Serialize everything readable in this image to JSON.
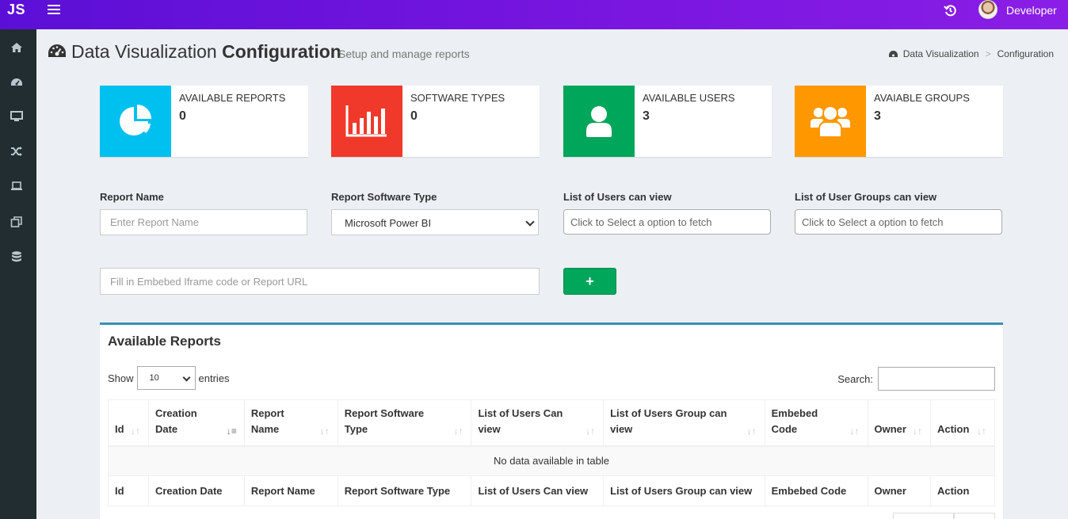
{
  "app": {
    "logo": "JS",
    "user_name": "Developer"
  },
  "sidebar": {
    "icons": [
      "home-icon",
      "dashboard-icon",
      "desktop-icon",
      "shuffle-icon",
      "laptop-icon",
      "clone-icon",
      "database-icon"
    ]
  },
  "header": {
    "title_light": "Data Visualization ",
    "title_bold": "Configuration",
    "subtitle": "Setup and manage reports",
    "breadcrumb": [
      "Data Visualization",
      "Configuration"
    ]
  },
  "info_boxes": [
    {
      "label": "AVAILABLE REPORTS",
      "value": "0",
      "color": "#00c0ef",
      "icon": "pie-chart-icon"
    },
    {
      "label": "SOFTWARE TYPES",
      "value": "0",
      "color": "#f39c12",
      "icon": "bar-chart-icon"
    },
    {
      "label": "AVAILABLE USERS",
      "value": "3",
      "color": "#00a65a",
      "icon": "user-icon"
    },
    {
      "label": "AVAIABLE GROUPS",
      "value": "3",
      "color": "#ff9800",
      "icon": "users-icon"
    }
  ],
  "form": {
    "report_name_label": "Report Name",
    "report_name_placeholder": "Enter Report Name",
    "software_type_label": "Report Software Type",
    "software_type_value": "Microsoft Power BI",
    "users_label": "List of Users can view",
    "users_placeholder": "Click to Select a option to fetch",
    "groups_label": "List of User Groups can view",
    "groups_placeholder": "Click to Select a option to fetch",
    "embed_placeholder": "Fill in Embebed Iframe code or Report URL",
    "add_button": "+"
  },
  "reports_table": {
    "title": "Available Reports",
    "show_label": "Show",
    "entries_value": "10",
    "entries_label": "entries",
    "search_label": "Search:",
    "header_columns": [
      "Id",
      "Creation Date",
      "Report Name",
      "Report Software Type",
      "List of Users Can view",
      "List of Users Group can view",
      "Embebed Code",
      "Owner",
      "Action"
    ],
    "footer_columns": [
      "Id",
      "Creation Date",
      "Report Name",
      "Report Software Type",
      "List of Users Can view",
      "List of Users Group can view",
      "Embebed Code",
      "Owner",
      "Action"
    ],
    "empty_message": "No data available in table"
  }
}
